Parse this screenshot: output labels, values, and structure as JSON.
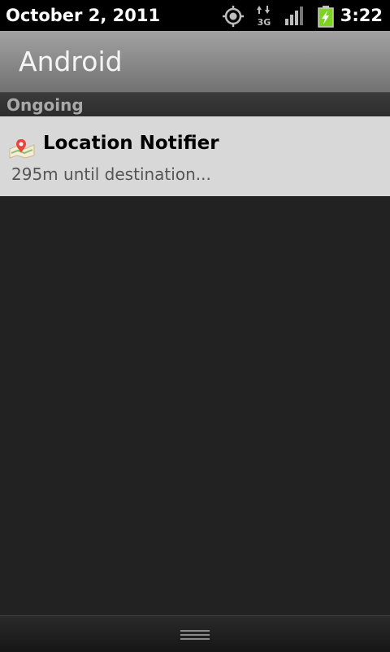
{
  "status_bar": {
    "date": "October 2, 2011",
    "time": "3:22",
    "icons": [
      "gps-icon",
      "3g-data-icon",
      "signal-strength-icon",
      "battery-charging-icon"
    ],
    "data_type": "3G"
  },
  "carrier": {
    "label": "Android"
  },
  "sections": {
    "ongoing": {
      "label": "Ongoing"
    }
  },
  "notifications": [
    {
      "icon": "map-pin-icon",
      "title": "Location Notifier",
      "text": "295m until destination..."
    }
  ],
  "colors": {
    "background": "#222222",
    "status_bar": "#000000",
    "notification_bg": "#d8d8d8",
    "battery_green": "#7ed321"
  }
}
